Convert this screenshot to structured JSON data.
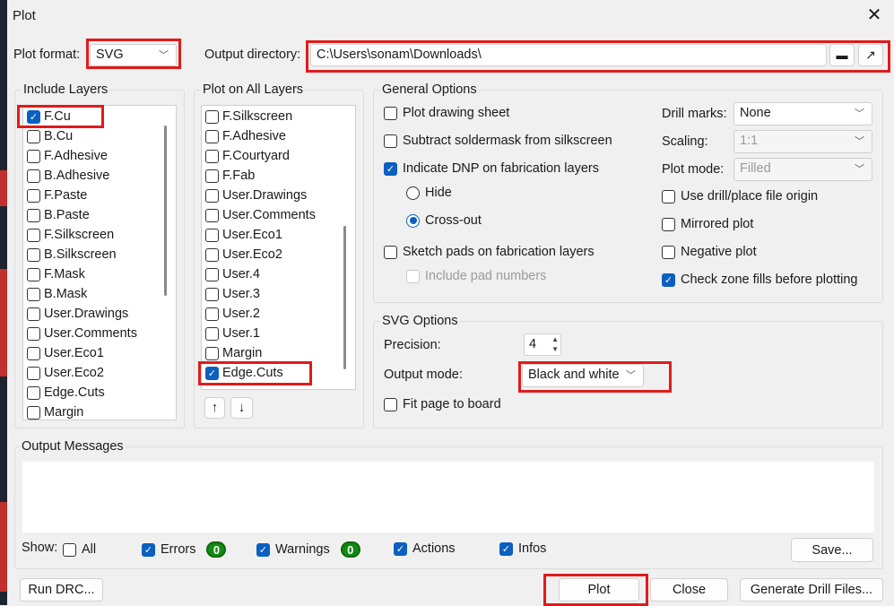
{
  "title": "Plot",
  "plot_format": {
    "label": "Plot format:",
    "value": "SVG"
  },
  "output_directory": {
    "label": "Output directory:",
    "value": "C:\\Users\\sonam\\Downloads\\"
  },
  "include_layers": {
    "title": "Include Layers",
    "items": [
      {
        "label": "F.Cu",
        "checked": true
      },
      {
        "label": "B.Cu",
        "checked": false
      },
      {
        "label": "F.Adhesive",
        "checked": false
      },
      {
        "label": "B.Adhesive",
        "checked": false
      },
      {
        "label": "F.Paste",
        "checked": false
      },
      {
        "label": "B.Paste",
        "checked": false
      },
      {
        "label": "F.Silkscreen",
        "checked": false
      },
      {
        "label": "B.Silkscreen",
        "checked": false
      },
      {
        "label": "F.Mask",
        "checked": false
      },
      {
        "label": "B.Mask",
        "checked": false
      },
      {
        "label": "User.Drawings",
        "checked": false
      },
      {
        "label": "User.Comments",
        "checked": false
      },
      {
        "label": "User.Eco1",
        "checked": false
      },
      {
        "label": "User.Eco2",
        "checked": false
      },
      {
        "label": "Edge.Cuts",
        "checked": false
      },
      {
        "label": "Margin",
        "checked": false
      }
    ]
  },
  "plot_all_layers": {
    "title": "Plot on All Layers",
    "items": [
      {
        "label": "F.Silkscreen",
        "checked": false
      },
      {
        "label": "F.Adhesive",
        "checked": false
      },
      {
        "label": "F.Courtyard",
        "checked": false
      },
      {
        "label": "F.Fab",
        "checked": false
      },
      {
        "label": "User.Drawings",
        "checked": false
      },
      {
        "label": "User.Comments",
        "checked": false
      },
      {
        "label": "User.Eco1",
        "checked": false
      },
      {
        "label": "User.Eco2",
        "checked": false
      },
      {
        "label": "User.4",
        "checked": false
      },
      {
        "label": "User.3",
        "checked": false
      },
      {
        "label": "User.2",
        "checked": false
      },
      {
        "label": "User.1",
        "checked": false
      },
      {
        "label": "Margin",
        "checked": false
      },
      {
        "label": "Edge.Cuts",
        "checked": true
      }
    ],
    "up": "↑",
    "down": "↓"
  },
  "general": {
    "title": "General Options",
    "plot_sheet": "Plot drawing sheet",
    "subtract_mask": "Subtract soldermask from silkscreen",
    "dnp": "Indicate DNP on fabrication layers",
    "hide": "Hide",
    "crossout": "Cross-out",
    "sketch": "Sketch pads on fabrication layers",
    "pad_numbers": "Include pad numbers",
    "drill_marks_label": "Drill marks:",
    "drill_marks": "None",
    "scaling_label": "Scaling:",
    "scaling": "1:1",
    "plot_mode_label": "Plot mode:",
    "plot_mode": "Filled",
    "drill_origin": "Use drill/place file origin",
    "mirrored": "Mirrored plot",
    "negative": "Negative plot",
    "check_zones": "Check zone fills before plotting"
  },
  "svg": {
    "title": "SVG Options",
    "precision_label": "Precision:",
    "precision": "4",
    "output_mode_label": "Output mode:",
    "output_mode": "Black and white",
    "fit_page": "Fit page to board"
  },
  "messages": {
    "title": "Output Messages",
    "show": "Show:",
    "all": "All",
    "errors": "Errors",
    "errors_count": "0",
    "warnings": "Warnings",
    "warnings_count": "0",
    "actions": "Actions",
    "infos": "Infos",
    "save": "Save..."
  },
  "buttons": {
    "run_drc": "Run DRC...",
    "plot": "Plot",
    "close": "Close",
    "drill": "Generate Drill Files..."
  },
  "colors": {
    "accent": "#0b5fc0",
    "highlight": "#e01b1b",
    "badge": "#138a13"
  }
}
